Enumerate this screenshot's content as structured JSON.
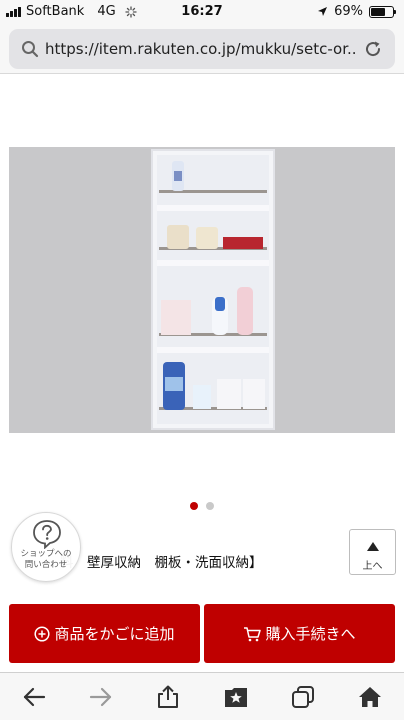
{
  "status_bar": {
    "carrier": "SoftBank",
    "network": "4G",
    "time": "16:27",
    "battery_percent_label": "69%",
    "battery_level": 0.69
  },
  "address_bar": {
    "url": "https://item.rakuten.co.jp/mukku/setc-or..."
  },
  "product": {
    "title_fragment": "料　壁厚収納　棚板・洗面収納】",
    "carousel": {
      "total": 2,
      "active_index": 0
    }
  },
  "help": {
    "label": "ショップへの\n問い合わせ"
  },
  "scroll_top": {
    "label": "上へ"
  },
  "actions": {
    "add_to_cart": "商品をかごに追加",
    "checkout": "購入手続きへ"
  },
  "colors": {
    "brand_red": "#bf0000",
    "image_bg": "#c8c8ca"
  },
  "toolbar": {
    "icons": [
      "back-icon",
      "forward-icon",
      "share-icon",
      "bookmarks-icon",
      "tabs-icon",
      "home-icon"
    ]
  }
}
